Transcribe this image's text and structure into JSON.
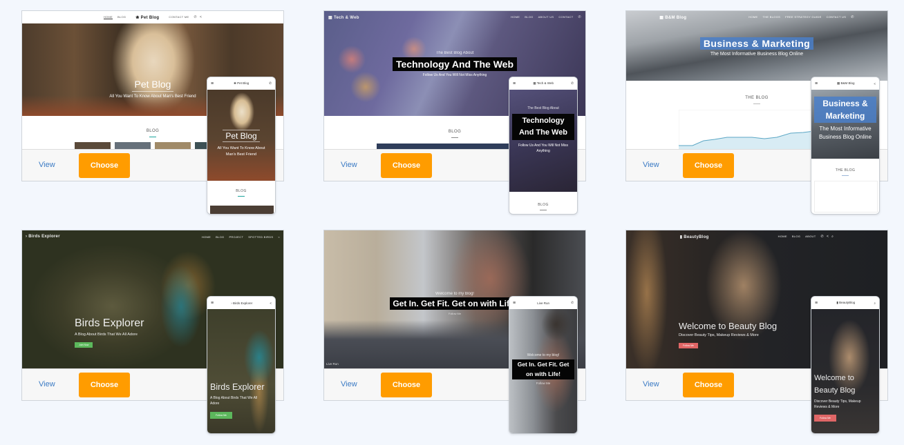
{
  "templates": [
    {
      "name": "Pet Blog",
      "view_label": "View",
      "choose_label": "Choose",
      "desktop": {
        "nav_links": [
          "HOME",
          "BLOG"
        ],
        "nav_right_links": [
          "CONTACT ME"
        ],
        "logo": "Pet Blog",
        "hero_title": "Pet Blog",
        "hero_subtitle": "All You Want To Know About Man's Best Friend",
        "section_title": "BLOG"
      },
      "mobile": {
        "logo": "Pet Blog",
        "hero_title": "Pet Blog",
        "hero_subtitle": "All You Want To Know About Man's Best Friend",
        "section_title": "BLOG"
      }
    },
    {
      "name": "Tech & Web",
      "view_label": "View",
      "choose_label": "Choose",
      "desktop": {
        "logo": "Tech & Web",
        "nav_links": [
          "HOME",
          "BLOG",
          "ABOUT US",
          "CONTACT"
        ],
        "hero_kicker": "The Best Blog About",
        "hero_title": "Technology And The Web",
        "hero_subtitle": "Follow Us And You Will Not Miss Anything",
        "section_title": "BLOG"
      },
      "mobile": {
        "logo": "Tech & Web",
        "hero_kicker": "The Best Blog About",
        "hero_title": "Technology And The Web",
        "hero_subtitle": "Follow Us And You Will Not Miss Anything",
        "section_title": "BLOG"
      }
    },
    {
      "name": "B&M Blog",
      "view_label": "View",
      "choose_label": "Choose",
      "desktop": {
        "logo": "B&M Blog",
        "nav_links": [
          "HOME",
          "THE BLOGS",
          "FREE STRATEGY GUIDE",
          "CONTACT US"
        ],
        "hero_title": "Business & Marketing",
        "hero_subtitle": "The Most Informative Business Blog Online",
        "section_title": "THE BLOG"
      },
      "mobile": {
        "logo": "B&M Blog",
        "hero_title": "Business & Marketing",
        "hero_subtitle": "The Most Informative Business Blog Online",
        "section_title": "THE BLOG"
      }
    },
    {
      "name": "Birds Explorer",
      "view_label": "View",
      "choose_label": "Choose",
      "desktop": {
        "logo": "Birds Explorer",
        "nav_links": [
          "HOME",
          "BLOG",
          "PROJECT",
          "SPOTTED BIRDS"
        ],
        "hero_title": "Birds Explorer",
        "hero_subtitle": "A Blog About Birds That We All Adore",
        "cta_label": "Join Now"
      },
      "mobile": {
        "logo": "Birds Explorer",
        "hero_title": "Birds Explorer",
        "hero_subtitle": "A Blog About Birds That We All Adore",
        "cta_label": "Follow Me"
      }
    },
    {
      "name": "Live Run",
      "view_label": "View",
      "choose_label": "Choose",
      "desktop": {
        "hero_kicker": "Welcome to my blog!",
        "hero_title": "Get In. Get Fit. Get on with Life!",
        "hero_subtitle": "Follow Me",
        "footer_brand": "Live Run"
      },
      "mobile": {
        "logo": "Live Run",
        "hero_kicker": "Welcome to my blog!",
        "hero_title": "Get In. Get Fit. Get on with Life!",
        "hero_subtitle": "Follow Me"
      }
    },
    {
      "name": "BeautyBlog",
      "view_label": "View",
      "choose_label": "Choose",
      "desktop": {
        "logo": "BeautyBlog",
        "nav_links": [
          "HOME",
          "BLOG",
          "ABOUT"
        ],
        "hero_title": "Welcome to Beauty Blog",
        "hero_subtitle": "Discover Beauty Tips, Makeup Reviews & More",
        "cta_label": "Follow Me"
      },
      "mobile": {
        "logo": "BeautyBlog",
        "hero_title": "Welcome to Beauty Blog",
        "hero_subtitle": "Discover Beauty Tips, Makeup Reviews & More",
        "cta_label": "Follow Me"
      }
    }
  ],
  "icons": {
    "phone": "✆",
    "share": "<",
    "search": "⌕",
    "menu": "≡",
    "paw": "❀",
    "bird": "›",
    "lipstick": "▮",
    "grid": "▦"
  },
  "colors": {
    "choose_button": "#ff9c00",
    "view_link": "#3a7ac4",
    "page_background": "#f3f7fd",
    "birds_cta": "#5cb85c",
    "beauty_cta": "#e06666",
    "business_highlight": "#4a7fc9"
  }
}
